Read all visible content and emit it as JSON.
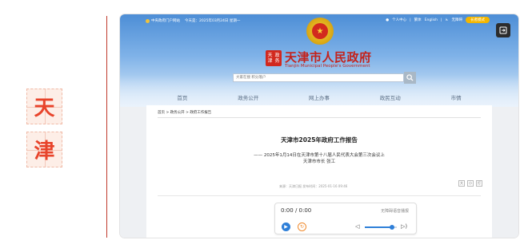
{
  "side": {
    "tile_chars": [
      "天",
      "津"
    ]
  },
  "topbar": {
    "left_link": "中央政府门户网站",
    "date_text": "今天是：2025年03月24日 星期一",
    "personal_center": "个人中心",
    "traditional": "繁体",
    "english": "English",
    "accessibility": "无障碍",
    "care_mode": "长者模式"
  },
  "header": {
    "seal_chars": [
      "天津",
      "政务"
    ],
    "title_cn": "天津市人民政府",
    "title_en": "Tianjin Municipal People's Government",
    "search_placeholder": "大家在搜 积分落户"
  },
  "nav": {
    "items": [
      "首页",
      "政务公开",
      "网上办事",
      "政民互动",
      "市情"
    ]
  },
  "breadcrumb": {
    "items": [
      "首页",
      "政务公开",
      "政府工作报告"
    ],
    "separator": ">"
  },
  "article": {
    "title": "天津市2025年政府工作报告",
    "subtitle_line1": "—— 2025年1月14日在天津市第十八届人民代表大会第三次会议上",
    "subtitle_line2": "天津市市长 张工",
    "meta": "来源：天津日报   发布时间：2025-01-16 09:46",
    "font_tools": [
      "大",
      "小",
      "打"
    ]
  },
  "player": {
    "time": "0:00 / 0:00",
    "hint": "无障碍语音播报",
    "volume_level": 0.85
  },
  "colors": {
    "accent": "#c4221b",
    "banner": "#4d8ed6",
    "play": "#2e7fd8",
    "replay": "#f08a2c",
    "care": "#f3b600"
  }
}
